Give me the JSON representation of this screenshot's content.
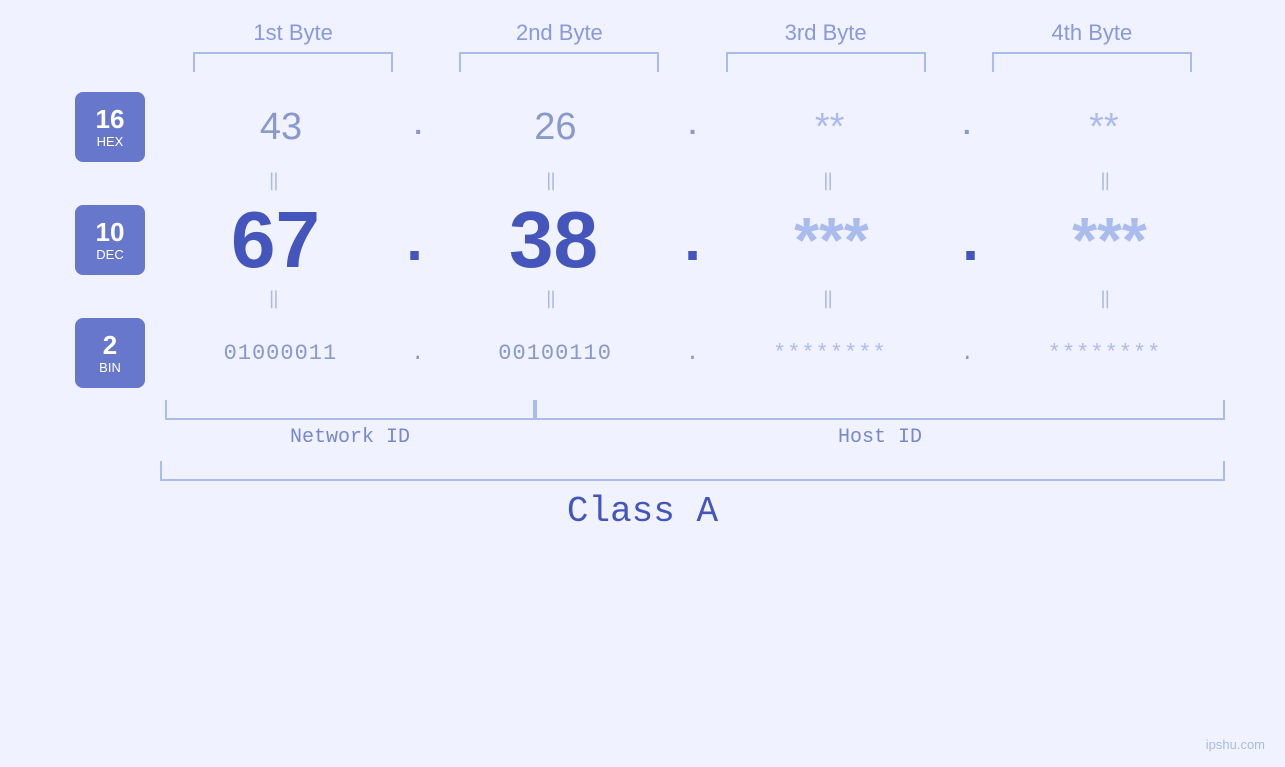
{
  "header": {
    "byte1_label": "1st Byte",
    "byte2_label": "2nd Byte",
    "byte3_label": "3rd Byte",
    "byte4_label": "4th Byte"
  },
  "bases": [
    {
      "number": "16",
      "text": "HEX"
    },
    {
      "number": "10",
      "text": "DEC"
    },
    {
      "number": "2",
      "text": "BIN"
    }
  ],
  "hex_row": {
    "b1": "43",
    "b2": "26",
    "b3": "**",
    "b4": "**"
  },
  "dec_row": {
    "b1": "67",
    "b2": "38",
    "b3": "***",
    "b4": "***"
  },
  "bin_row": {
    "b1": "01000011",
    "b2": "00100110",
    "b3": "********",
    "b4": "********"
  },
  "labels": {
    "network_id": "Network ID",
    "host_id": "Host ID",
    "class": "Class A"
  },
  "watermark": "ipshu.com",
  "colors": {
    "accent": "#6677cc",
    "light_text": "#8899cc",
    "dark_text": "#4455bb",
    "bracket": "#aabbee",
    "masked_hex": "#aabbee",
    "masked_dec": "#aabbee",
    "masked_bin": "#aabbee"
  }
}
